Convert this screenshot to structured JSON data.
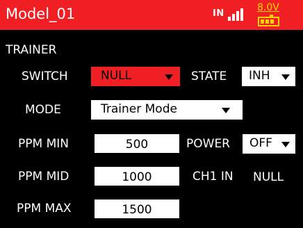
{
  "header": {
    "title": "Model_01",
    "signal_text": "IN",
    "voltage": "8.0V",
    "header_color": "#ef1f24",
    "battery_color": "#ffd400"
  },
  "section_title": "TRAINER",
  "switch": {
    "label": "SWITCH",
    "value": "NULL"
  },
  "state": {
    "label": "STATE",
    "value": "INH"
  },
  "mode": {
    "label": "MODE",
    "value": "Trainer Mode"
  },
  "ppm_min": {
    "label": "PPM MIN",
    "value": "500"
  },
  "power": {
    "label": "POWER",
    "value": "OFF"
  },
  "ppm_mid": {
    "label": "PPM MID",
    "value": "1000"
  },
  "ch1_in": {
    "label": "CH1 IN",
    "value": "NULL"
  },
  "ppm_max": {
    "label": "PPM MAX",
    "value": "1500"
  }
}
